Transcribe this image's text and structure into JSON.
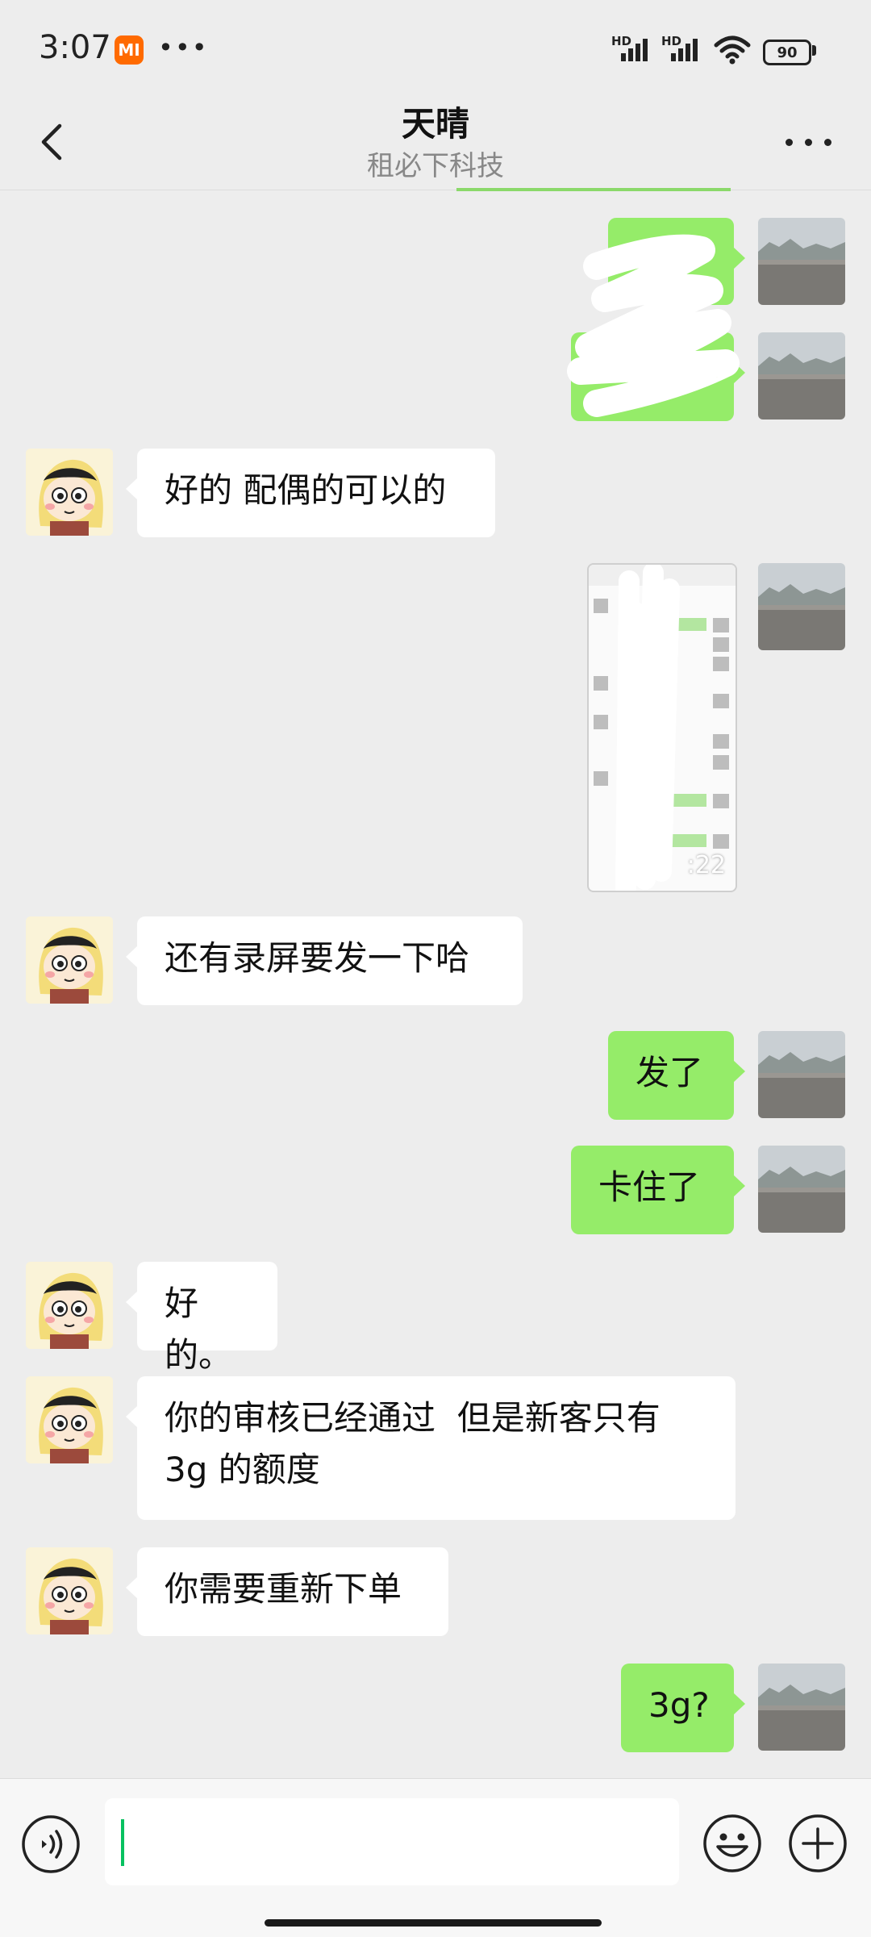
{
  "status_bar": {
    "time": "3:07",
    "mi_label": "MI",
    "more_dots": "•••",
    "hd_label_1": "HD",
    "hd_label_2": "HD",
    "battery": "90"
  },
  "header": {
    "title": "天晴",
    "subtitle": "租必下科技"
  },
  "messages": {
    "m1": "",
    "m2": "",
    "m3": "好的 配偶的可以的",
    "m4_video_duration": ":22",
    "m5": "还有录屏要发一下哈",
    "m6": "发了",
    "m7": "卡住了",
    "m8": "好的。",
    "m9_line1": "你的审核已经通过  但是新客只有",
    "m9_line2": "3g 的额度",
    "m10": "你需要重新下单",
    "m11": "3g?"
  },
  "input_bar": {
    "text_value": ""
  },
  "colors": {
    "chat_background": "#ededed",
    "outgoing_bubble": "#95ec69",
    "incoming_bubble": "#ffffff",
    "accent": "#07c160"
  },
  "icons": [
    "back-arrow-icon",
    "more-icon",
    "voice-icon",
    "emoji-icon",
    "plus-icon"
  ]
}
